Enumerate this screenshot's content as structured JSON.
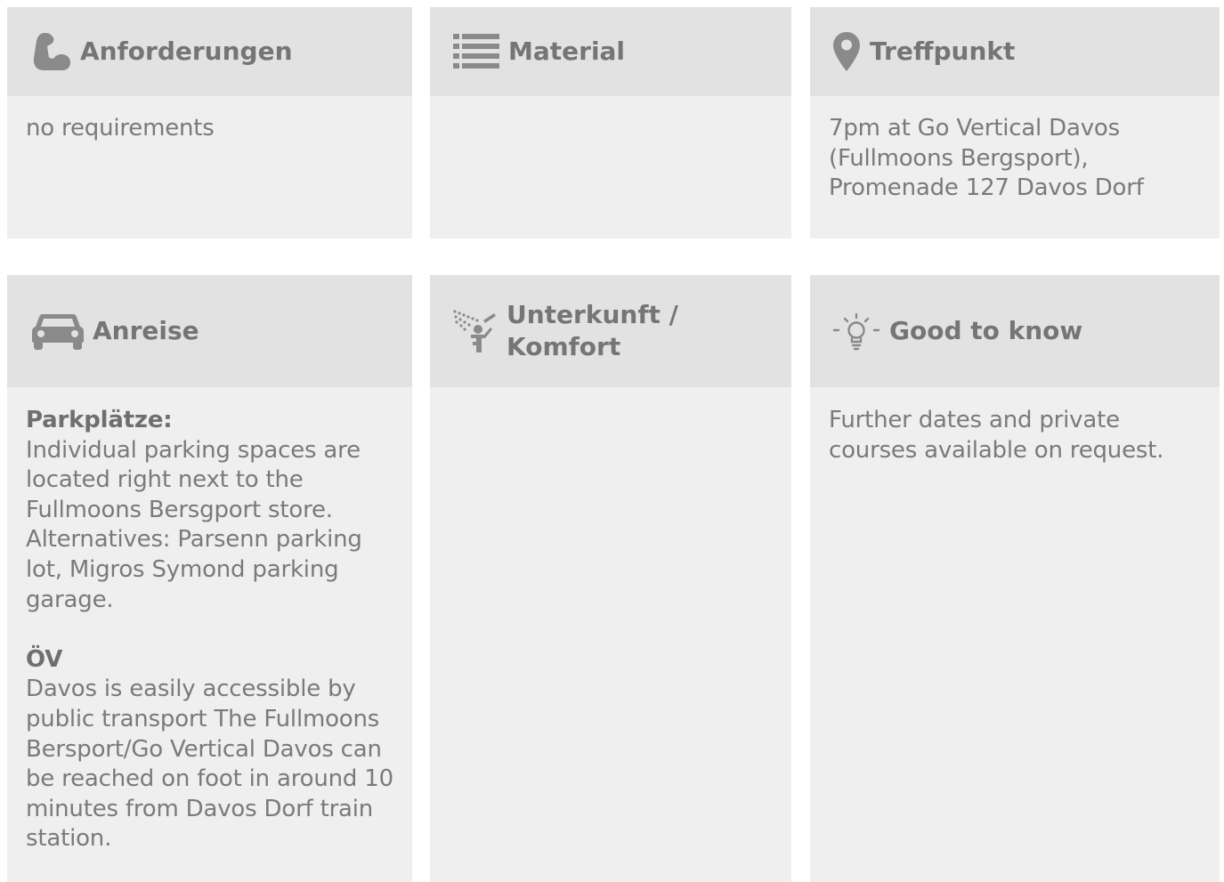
{
  "cards": {
    "requirements": {
      "title": "Anforderungen",
      "icon": "flexed-arm-icon",
      "text": "no requirements"
    },
    "material": {
      "title": "Material",
      "icon": "list-icon",
      "text": ""
    },
    "meeting_point": {
      "title": "Treffpunkt",
      "icon": "map-pin-icon",
      "lines": [
        "7pm at Go Vertical Davos",
        "(Fullmoons Bergsport),",
        "Promenade 127 Davos Dorf"
      ]
    },
    "arrival": {
      "title": "Anreise",
      "icon": "car-icon",
      "parking_heading": "Parkplätze:",
      "parking_lines": [
        "Individual parking spaces are",
        "located right next to the",
        "Fullmoons Bersgport store.",
        "Alternatives: Parsenn parking",
        "lot, Migros Symond parking",
        "garage."
      ],
      "transport_heading": "ÖV",
      "transport_lines": [
        "Davos is easily accessible by",
        "public transport The Fullmoons",
        "Bersport/Go Vertical Davos can",
        "be reached on foot in around 10",
        "minutes from Davos Dorf train",
        "station."
      ]
    },
    "accommodation": {
      "title_line1": "Unterkunft /",
      "title_line2": "Komfort",
      "icon": "shower-icon",
      "text": ""
    },
    "good_to_know": {
      "title": "Good to know",
      "icon": "lightbulb-icon",
      "lines": [
        "Further dates and private",
        "courses available on request."
      ]
    }
  },
  "colors": {
    "header_bg": "#e2e2e2",
    "body_bg": "#efefef",
    "title_text": "#757575",
    "body_text": "#7a7a7a"
  }
}
